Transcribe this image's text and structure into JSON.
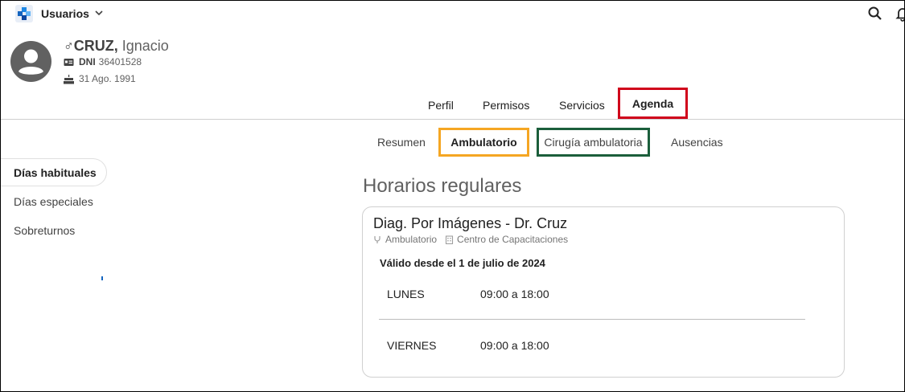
{
  "app": {
    "name": "Usuarios"
  },
  "user": {
    "gender_symbol": "♂",
    "last_name": "CRUZ,",
    "first_name": "Ignacio",
    "dni_label": "DNI",
    "dni": "36401528",
    "birthdate": "31 Ago. 1991"
  },
  "main_tabs": [
    "Perfil",
    "Permisos",
    "Servicios",
    "Agenda"
  ],
  "sub_tabs": [
    "Resumen",
    "Ambulatorio",
    "Cirugía ambulatoria",
    "Ausencias"
  ],
  "side_menu": [
    "Días habituales",
    "Días especiales",
    "Sobreturnos"
  ],
  "section_title": "Horarios regulares",
  "card": {
    "title": "Diag. Por Imágenes - Dr. Cruz",
    "type": "Ambulatorio",
    "location": "Centro de Capacitaciones",
    "valid_from": "Válido desde el 1 de julio de 2024",
    "schedule": [
      {
        "day": "LUNES",
        "hours": "09:00 a 18:00"
      },
      {
        "day": "VIERNES",
        "hours": "09:00 a 18:00"
      }
    ]
  },
  "colors": {
    "agenda_highlight": "#d0021b",
    "ambulatorio_highlight": "#f5a623",
    "cirugia_highlight": "#1b5e3b"
  },
  "icons": {
    "logo": "app-logo-icon",
    "search": "search-icon",
    "notifications": "bell-icon",
    "avatar": "avatar-icon",
    "dni": "id-card-icon",
    "birthdate": "cake-icon",
    "type": "stethoscope-icon",
    "location": "building-icon"
  }
}
